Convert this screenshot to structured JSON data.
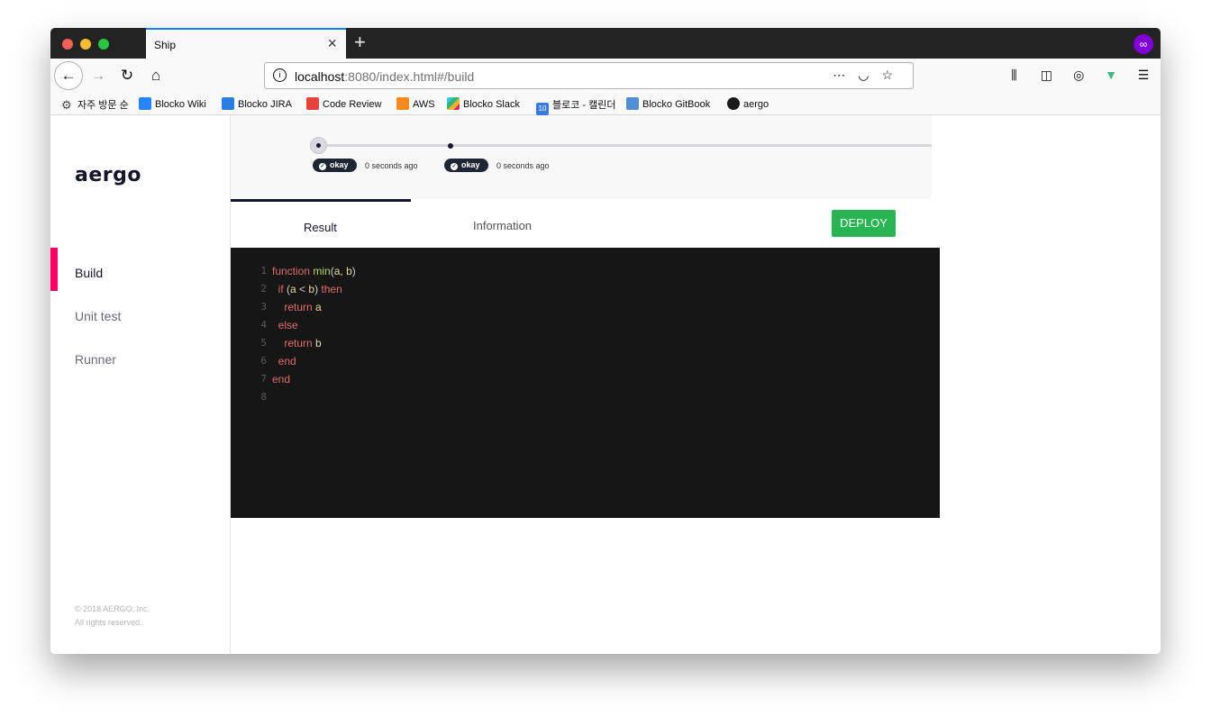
{
  "browser": {
    "tab_title": "Ship",
    "url_host": "localhost",
    "url_rest": ":8080/index.html#/build",
    "bookmarks": [
      "자주 방문 순",
      "Blocko Wiki",
      "Blocko JIRA",
      "Code Review",
      "AWS",
      "Blocko Slack",
      "블로코 - 캘린더",
      "Blocko GitBook",
      "aergo"
    ],
    "bookmark_icons": [
      "gear-icon",
      "confluence-icon",
      "jira-icon",
      "code-review-icon",
      "aws-icon",
      "slack-icon",
      "calendar-icon",
      "gitbook-icon",
      "github-icon"
    ],
    "calendar_day": "10"
  },
  "sidebar": {
    "logo": "aergo",
    "items": [
      {
        "label": "Build",
        "active": true
      },
      {
        "label": "Unit test",
        "active": false
      },
      {
        "label": "Runner",
        "active": false
      }
    ],
    "footer_line1": "© 2018 AERGO, Inc.",
    "footer_line2": "All rights reserved."
  },
  "timeline": {
    "events": [
      {
        "status": "okay",
        "time": "0 seconds ago"
      },
      {
        "status": "okay",
        "time": "0 seconds ago"
      }
    ]
  },
  "tabs": {
    "result": "Result",
    "information": "Information",
    "deploy": "DEPLOY"
  },
  "editor": {
    "line_numbers": [
      "1",
      "2",
      "3",
      "4",
      "5",
      "6",
      "7",
      "8"
    ]
  },
  "colors": {
    "accent": "#ff0066",
    "deploy_green": "#28b552",
    "editor_bg": "#161616"
  }
}
